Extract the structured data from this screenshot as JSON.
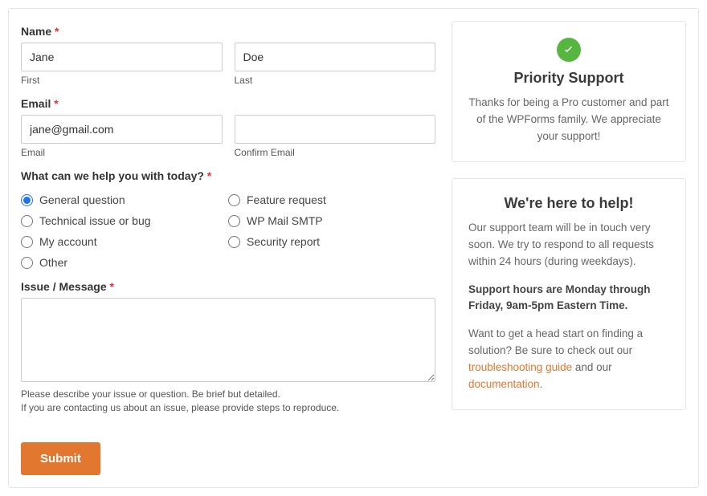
{
  "form": {
    "name": {
      "label": "Name",
      "first_value": "Jane",
      "first_sub": "First",
      "last_value": "Doe",
      "last_sub": "Last"
    },
    "email": {
      "label": "Email",
      "value": "jane@gmail.com",
      "sub": "Email",
      "confirm_value": "",
      "confirm_sub": "Confirm Email"
    },
    "help": {
      "label": "What can we help you with today?",
      "options_col1": [
        "General question",
        "Technical issue or bug",
        "My account",
        "Other"
      ],
      "options_col2": [
        "Feature request",
        "WP Mail SMTP",
        "Security report"
      ],
      "selected": "General question"
    },
    "message": {
      "label": "Issue / Message",
      "value": "",
      "hint1": "Please describe your issue or question. Be brief but detailed.",
      "hint2": "If you are contacting us about an issue, please provide steps to reproduce."
    },
    "submit": "Submit",
    "required_mark": "*"
  },
  "sidebar": {
    "priority": {
      "title": "Priority Support",
      "text": "Thanks for being a Pro customer and part of the WPForms family. We appreciate your support!"
    },
    "help": {
      "title": "We're here to help!",
      "p1": "Our support team will be in touch very soon. We try to respond to all requests within 24 hours (during weekdays).",
      "p2": "Support hours are Monday through Friday, 9am-5pm Eastern Time.",
      "p3a": "Want to get a head start on finding a solution? Be sure to check out our ",
      "link1": "troubleshooting guide",
      "p3b": " and our ",
      "link2": "documentation",
      "p3c": "."
    }
  }
}
